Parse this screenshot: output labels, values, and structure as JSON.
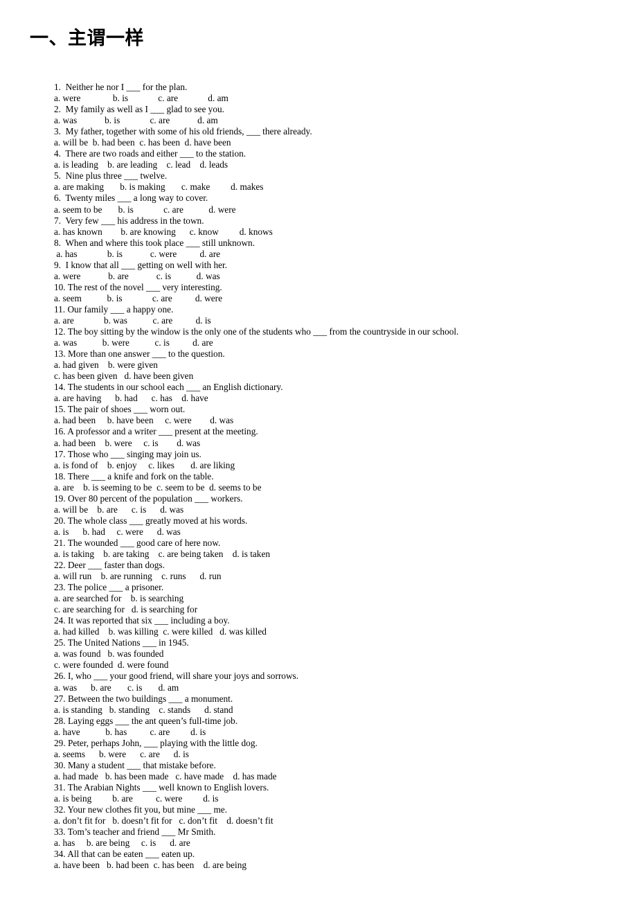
{
  "document": {
    "title": "一、主谓一样",
    "lines": [
      "1.  Neither he nor I ___ for the plan.",
      "a. were              b. is             c. are             d. am",
      "2.  My family as well as I ___ glad to see you.",
      "a. was            b. is             c. are            d. am",
      "3.  My father, together with some of his old friends, ___ there already.",
      "a. will be  b. had been  c. has been  d. have been",
      "4.  There are two roads and either ___ to the station.",
      "a. is leading    b. are leading    c. lead    d. leads",
      "5.  Nine plus three ___ twelve.",
      "a. are making       b. is making       c. make         d. makes",
      "6.  Twenty miles ___ a long way to cover.",
      "a. seem to be       b. is             c. are           d. were",
      "7.  Very few ___ his address in the town.",
      "a. has known        b. are knowing      c. know         d. knows",
      "8.  When and where this took place ___ still unknown.",
      " a. has             b. is            c. were          d. are",
      "9.  I know that all ___ getting on well with her.",
      "a. were            b. are            c. is           d. was",
      "10. The rest of the novel ___ very interesting.",
      "a. seem           b. is             c. are          d. were",
      "11. Our family ___ a happy one.",
      "a. are             b. was           c. are          d. is",
      "12. The boy sitting by the window is the only one of the students who ___ from the countryside in our school.",
      "a. was           b. were           c. is          d. are",
      "13. More than one answer ___ to the question.",
      "a. had given    b. were given",
      "c. has been given   d. have been given",
      "14. The students in our school each ___ an English dictionary.",
      "a. are having      b. had      c. has    d. have",
      "15. The pair of shoes ___ worn out.",
      "a. had been     b. have been     c. were        d. was",
      "16. A professor and a writer ___ present at the meeting.",
      "a. had been    b. were     c. is        d. was",
      "17. Those who ___ singing may join us.",
      "a. is fond of    b. enjoy     c. likes       d. are liking",
      "18. There ___ a knife and fork on the table.",
      "a. are    b. is seeming to be  c. seem to be  d. seems to be",
      "19. Over 80 percent of the population ___ workers.",
      "a. will be    b. are      c. is      d. was",
      "20. The whole class ___ greatly moved at his words.",
      "a. is      b. had     c. were      d. was",
      "21. The wounded ___ good care of here now.",
      "a. is taking    b. are taking    c. are being taken    d. is taken",
      "22. Deer ___ faster than dogs.",
      "a. will run    b. are running    c. runs      d. run",
      "23. The police ___ a prisoner.",
      "a. are searched for    b. is searching",
      "c. are searching for   d. is searching for",
      "24. It was reported that six ___ including a boy.",
      "a. had killed    b. was killing  c. were killed   d. was killed",
      "25. The United Nations ___ in 1945.",
      "a. was found   b. was founded",
      "c. were founded  d. were found",
      "26. I, who ___ your good friend, will share your joys and sorrows.",
      "a. was      b. are       c. is       d. am",
      "27. Between the two buildings ___ a monument.",
      "a. is standing   b. standing    c. stands      d. stand",
      "28. Laying eggs ___ the ant queen’s full-time job.",
      "a. have           b. has          c. are         d. is",
      "29. Peter, perhaps John, ___ playing with the little dog.",
      "a. seems      b. were      c. are      d. is",
      "30. Many a student ___ that mistake before.",
      "a. had made   b. has been made   c. have made    d. has made",
      "31. The Arabian Nights ___ well known to English lovers.",
      "a. is being         b. are          c. were         d. is",
      "32. Your new clothes fit you, but mine ___ me.",
      "a. don’t fit for   b. doesn’t fit for   c. don’t fit    d. doesn’t fit",
      "33. Tom’s teacher and friend ___ Mr Smith.",
      "a. has     b. are being     c. is      d. are",
      "34. All that can be eaten ___ eaten up.",
      "a. have been   b. had been  c. has been    d. are being"
    ]
  }
}
